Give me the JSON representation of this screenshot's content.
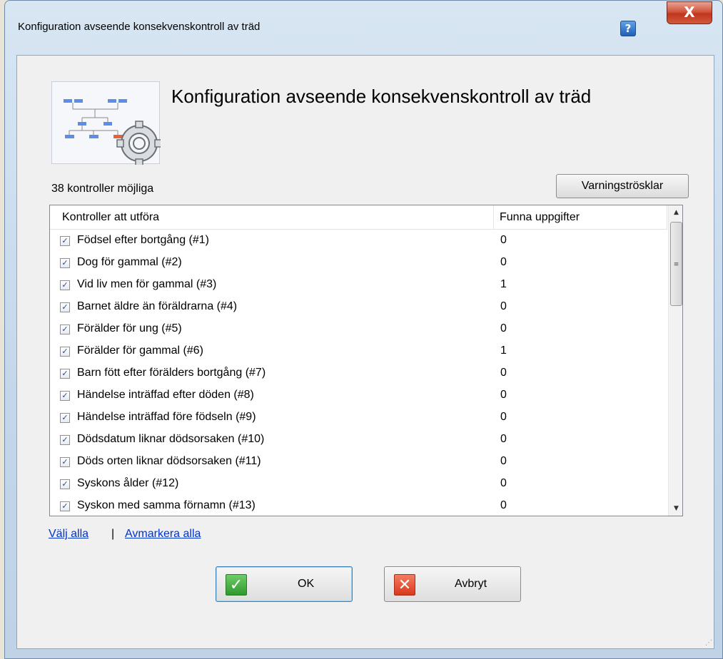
{
  "window": {
    "title": "Konfiguration avseende konsekvenskontroll av träd",
    "help_glyph": "?",
    "close_glyph": "X"
  },
  "dialog": {
    "heading": "Konfiguration avseende konsekvenskontroll av träd",
    "count_label": "38 kontroller möjliga",
    "thresholds_button": "Varningströsklar"
  },
  "list": {
    "columns": [
      "Kontroller att utföra",
      "Funna uppgifter"
    ],
    "rows": [
      {
        "name": "Födsel efter bortgång (#1)",
        "found": "0",
        "checked": true
      },
      {
        "name": "Dog för gammal (#2)",
        "found": "0",
        "checked": true
      },
      {
        "name": "Vid liv men för gammal (#3)",
        "found": "1",
        "checked": true
      },
      {
        "name": "Barnet äldre än föräldrarna (#4)",
        "found": "0",
        "checked": true
      },
      {
        "name": "Förälder för ung (#5)",
        "found": "0",
        "checked": true
      },
      {
        "name": "Förälder för gammal (#6)",
        "found": "1",
        "checked": true
      },
      {
        "name": "Barn fött efter förälders bortgång (#7)",
        "found": "0",
        "checked": true
      },
      {
        "name": "Händelse inträffad efter döden (#8)",
        "found": "0",
        "checked": true
      },
      {
        "name": "Händelse inträffad före födseln (#9)",
        "found": "0",
        "checked": true
      },
      {
        "name": "Dödsdatum liknar dödsorsaken (#10)",
        "found": "0",
        "checked": true
      },
      {
        "name": "Döds orten liknar dödsorsaken (#11)",
        "found": "0",
        "checked": true
      },
      {
        "name": "Syskons ålder (#12)",
        "found": "0",
        "checked": true
      },
      {
        "name": "Syskon med samma förnamn (#13)",
        "found": "0",
        "checked": true
      }
    ]
  },
  "links": {
    "select_all": "Välj alla",
    "separator": "|",
    "deselect_all": "Avmarkera alla"
  },
  "buttons": {
    "ok": "OK",
    "cancel": "Avbryt"
  },
  "icons": {
    "header": "family-tree-gear-icon",
    "ok": "checkmark-icon",
    "cancel": "cross-icon"
  },
  "colors": {
    "link": "#0033cc",
    "ok_icon": "#2f9a2c",
    "cancel_icon": "#d9381c",
    "close_button": "#c0351e"
  }
}
